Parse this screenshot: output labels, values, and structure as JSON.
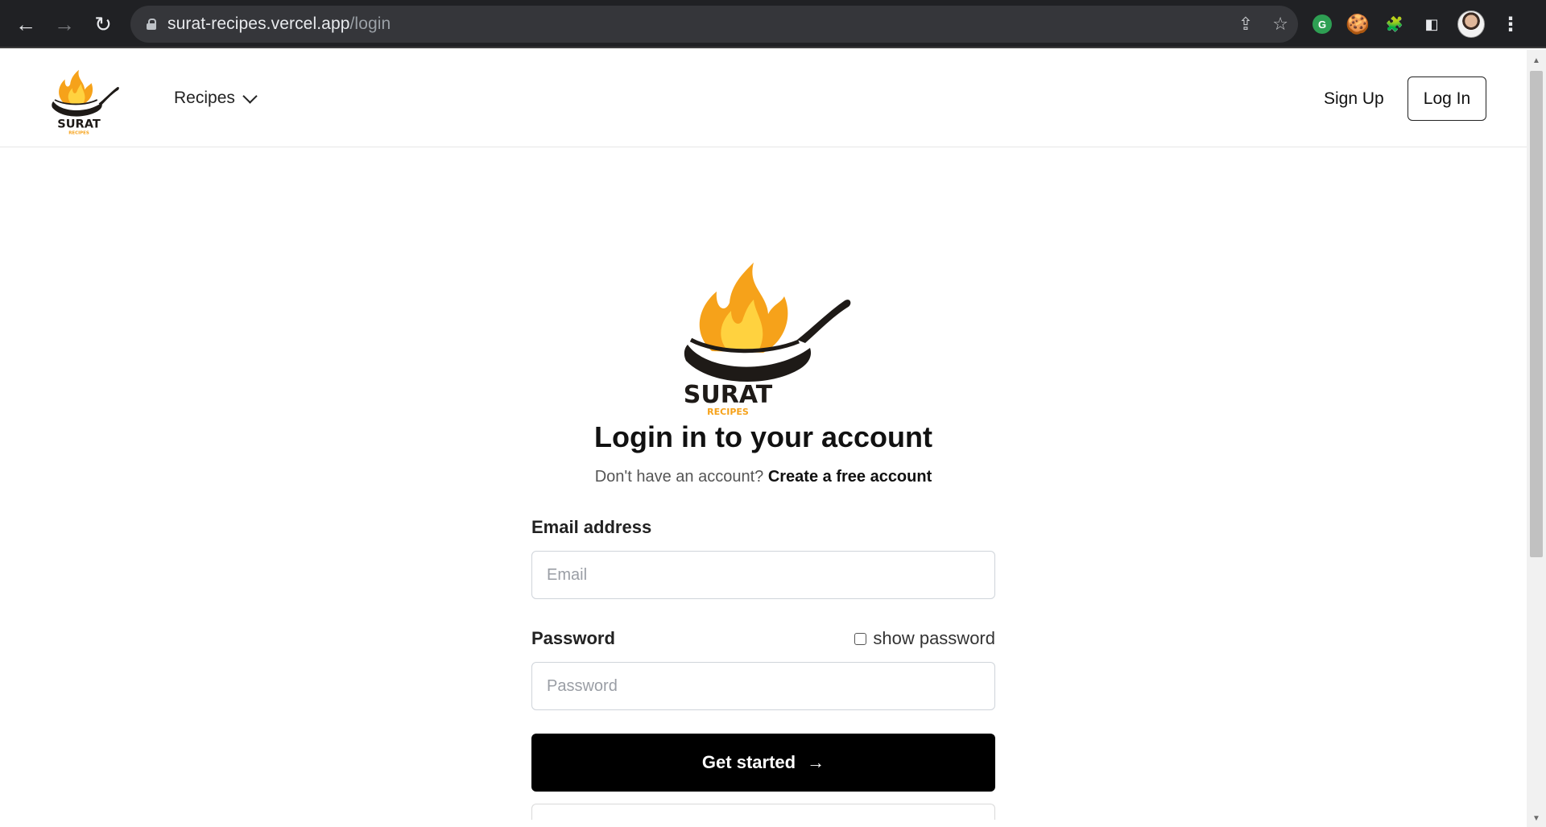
{
  "browser": {
    "url_host": "surat-recipes.vercel.app",
    "url_path": "/login",
    "back_icon": "←",
    "forward_icon": "→",
    "reload_icon": "↻",
    "share_icon": "⇪",
    "star_icon": "☆",
    "ext_green_label": "G",
    "ext_cookie_icon": "🍪",
    "puzzle_icon": "🧩",
    "sidepanel_icon": "◧",
    "menu_icon": "⋮"
  },
  "header": {
    "brand_name": "SURAT",
    "brand_tagline": "RECIPES",
    "nav_recipes": "Recipes",
    "signup_label": "Sign Up",
    "login_label": "Log In"
  },
  "main": {
    "logo_name": "SURAT",
    "logo_tagline": "RECIPES",
    "title": "Login in to your account",
    "subtitle_prefix": "Don't have an account?",
    "create_link": "Create a free account",
    "email_label": "Email address",
    "email_placeholder": "Email",
    "email_value": "",
    "password_label": "Password",
    "show_password_label": "show password",
    "show_password_checked": false,
    "password_placeholder": "Password",
    "password_value": "",
    "submit_label": "Get started",
    "submit_arrow": "→"
  },
  "colors": {
    "chrome_bg": "#202124",
    "omnibox_bg": "#35363a",
    "flame_orange": "#f6a21a",
    "flame_yellow": "#ffd23f",
    "pan_dark": "#1e1a17",
    "primary_button": "#000000"
  }
}
